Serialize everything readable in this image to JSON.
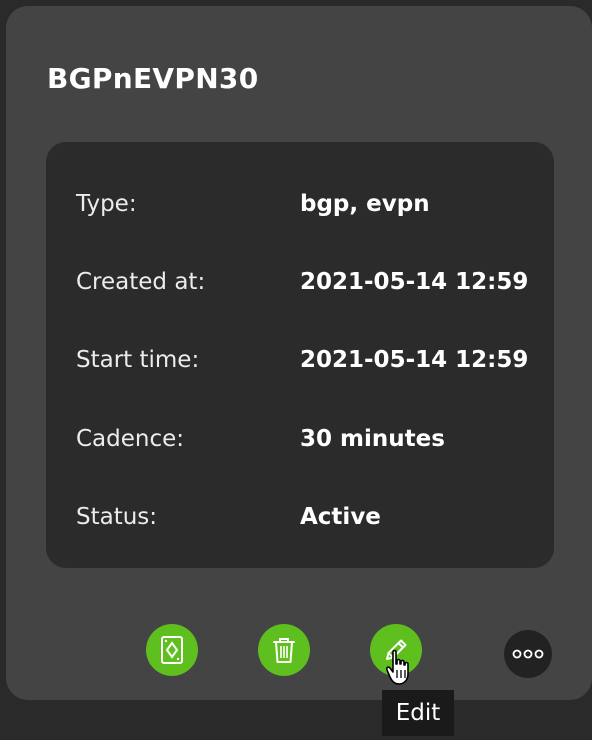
{
  "card": {
    "title": "BGPnEVPN30",
    "details": [
      {
        "label": "Type:",
        "value": "bgp, evpn"
      },
      {
        "label": "Created at:",
        "value": "2021-05-14 12:59"
      },
      {
        "label": "Start time:",
        "value": "2021-05-14 12:59"
      },
      {
        "label": "Cadence:",
        "value": "30 minutes"
      },
      {
        "label": "Status:",
        "value": "Active"
      }
    ]
  },
  "actions": {
    "icons": [
      "card-icon",
      "trash-icon",
      "pencil-icon",
      "ellipsis-icon"
    ],
    "tooltip": "Edit"
  },
  "colors": {
    "accent": "#5fbf1e",
    "card_bg": "#444444",
    "panel_bg": "#2b2b2b",
    "page_bg": "#2a2a2a"
  }
}
